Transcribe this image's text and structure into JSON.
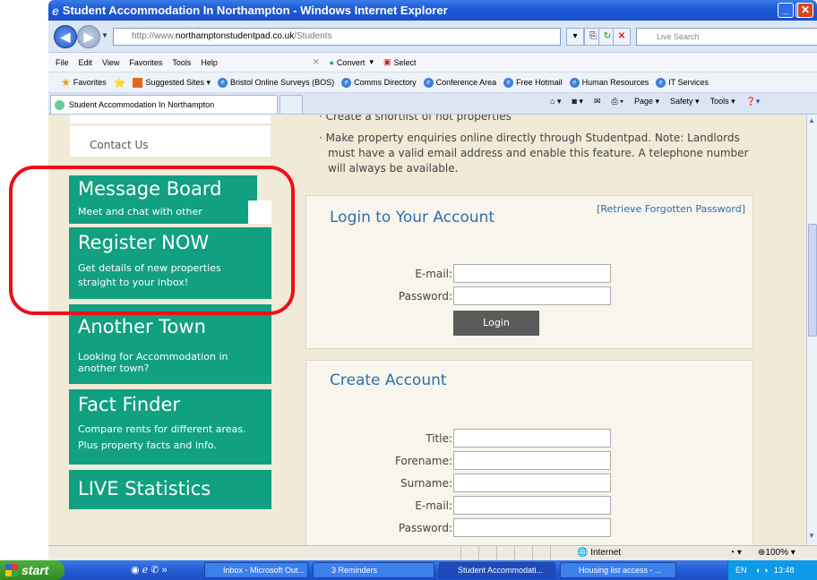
{
  "window": {
    "title": "Student Accommodation In Northampton - Windows Internet Explorer",
    "url_prefix": "http://www.",
    "url_domain": "northamptonstudentpad.co.uk",
    "url_path": "/Students",
    "search_placeholder": "Live Search"
  },
  "menu": [
    "File",
    "Edit",
    "View",
    "Favorites",
    "Tools",
    "Help"
  ],
  "toolbar": {
    "convert": "Convert",
    "select": "Select"
  },
  "favorites": {
    "label": "Favorites",
    "items": [
      "Suggested Sites ▾",
      "Bristol Online Surveys (BOS)",
      "Comms Directory",
      "Conference Area",
      "Free Hotmail",
      "Human Resources",
      "IT Services"
    ]
  },
  "tab": {
    "title": "Student Accommodation In Northampton"
  },
  "commandbar": {
    "page": "Page ▾",
    "safety": "Safety ▾",
    "tools": "Tools ▾"
  },
  "sidebar": {
    "contact": "Contact Us",
    "boxes": [
      {
        "title": "Message Board",
        "subtitle": "Meet and chat with other"
      },
      {
        "title": "Register NOW",
        "subtitle": "Get details of new properties straight to your inbox!"
      },
      {
        "title": "Another Town",
        "subtitle": "Looking for Accommodation in another town?"
      },
      {
        "title": "Fact Finder",
        "subtitle": "Compare rents for different areas. Plus property facts and info."
      },
      {
        "title": "LIVE Statistics",
        "subtitle": ""
      }
    ]
  },
  "main": {
    "bullets": [
      "Create a shortlist of hot properties",
      "Make property enquiries online directly through Studentpad. Note: Landlords must have a valid email address and enable this feature. A telephone number will always be available."
    ],
    "login": {
      "title": "Login to Your Account",
      "forgot": "[Retrieve Forgotten Password]",
      "email_label": "E-mail:",
      "password_label": "Password:",
      "button": "Login"
    },
    "create": {
      "title": "Create Account",
      "fields": [
        "Title:",
        "Forename:",
        "Surname:",
        "E-mail:",
        "Password:"
      ]
    }
  },
  "status": {
    "zone": "Internet",
    "zoom": "100%"
  },
  "taskbar": {
    "start": "start",
    "tasks": [
      "Inbox - Microsoft Out...",
      "3 Reminders",
      "Student Accommodati...",
      "Housing list access - ..."
    ],
    "lang": "EN",
    "clock": "13:48"
  }
}
